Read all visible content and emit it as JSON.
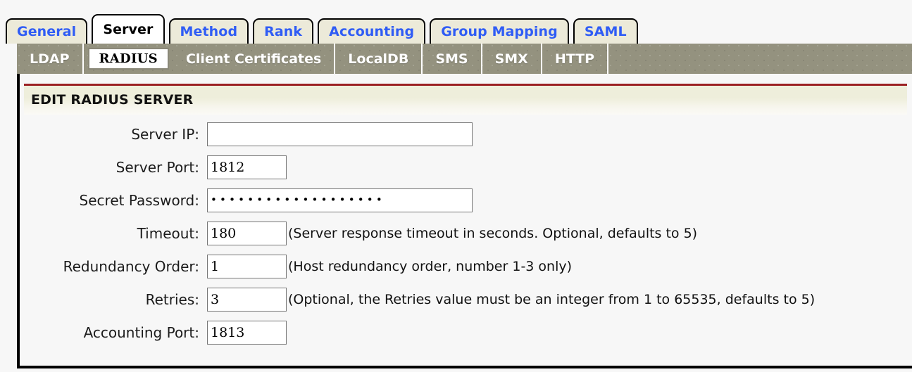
{
  "tabs": [
    {
      "label": "General",
      "active": false
    },
    {
      "label": "Server",
      "active": true
    },
    {
      "label": "Method",
      "active": false
    },
    {
      "label": "Rank",
      "active": false
    },
    {
      "label": "Accounting",
      "active": false
    },
    {
      "label": "Group Mapping",
      "active": false
    },
    {
      "label": "SAML",
      "active": false
    }
  ],
  "subtabs": [
    {
      "label": "LDAP",
      "active": false
    },
    {
      "label": "RADIUS",
      "active": true
    },
    {
      "label": "Client Certificates",
      "active": false
    },
    {
      "label": "LocalDB",
      "active": false
    },
    {
      "label": "SMS",
      "active": false
    },
    {
      "label": "SMX",
      "active": false
    },
    {
      "label": "HTTP",
      "active": false
    }
  ],
  "section": {
    "title": "EDIT RADIUS SERVER"
  },
  "fields": [
    {
      "label": "Server IP:",
      "value": "",
      "size": "wide",
      "type": "text",
      "hint": ""
    },
    {
      "label": "Server Port:",
      "value": "1812",
      "size": "small",
      "type": "text",
      "hint": ""
    },
    {
      "label": "Secret Password:",
      "value": "•••••••••••••••••••",
      "size": "wide",
      "type": "password",
      "hint": ""
    },
    {
      "label": "Timeout:",
      "value": "180",
      "size": "small",
      "type": "text",
      "hint": "(Server response timeout in seconds. Optional, defaults to 5)"
    },
    {
      "label": "Redundancy Order:",
      "value": "1",
      "size": "small",
      "type": "text",
      "hint": "(Host redundancy order, number 1-3 only)"
    },
    {
      "label": "Retries:",
      "value": "3",
      "size": "small",
      "type": "text",
      "hint": "(Optional, the Retries value must be an integer from 1 to 65535, defaults to 5)"
    },
    {
      "label": "Accounting Port:",
      "value": "1813",
      "size": "small",
      "type": "text",
      "hint": ""
    }
  ],
  "colors": {
    "tab_inactive_bg": "#ecead9",
    "tab_active_bg": "#ffffff",
    "tab_link_text": "#2f5cf5",
    "subbar_bg": "#94927f",
    "section_rule": "#9b2023",
    "section_bg": "#eeeedb",
    "page_bg": "#f7f7f7"
  }
}
